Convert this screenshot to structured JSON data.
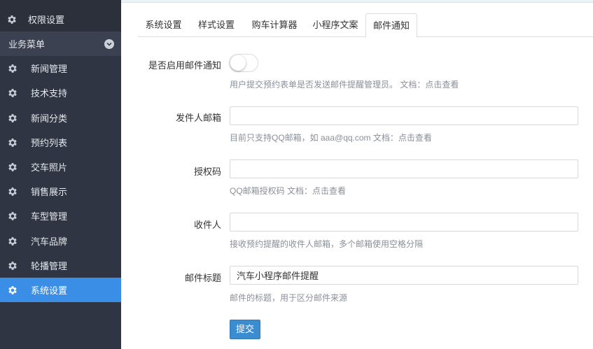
{
  "sidebar": {
    "top_item": {
      "label": "权限设置",
      "icon": "gear-icon"
    },
    "group": {
      "label": "业务菜单",
      "icon": "chevron-down-icon"
    },
    "items": [
      {
        "label": "新闻管理",
        "icon": "gear-icon"
      },
      {
        "label": "技术支持",
        "icon": "gear-icon"
      },
      {
        "label": "新闻分类",
        "icon": "gear-icon"
      },
      {
        "label": "预约列表",
        "icon": "gear-icon"
      },
      {
        "label": "交车照片",
        "icon": "gear-icon"
      },
      {
        "label": "销售展示",
        "icon": "gear-icon"
      },
      {
        "label": "车型管理",
        "icon": "gear-icon"
      },
      {
        "label": "汽车品牌",
        "icon": "gear-icon"
      },
      {
        "label": "轮播管理",
        "icon": "gear-icon"
      },
      {
        "label": "系统设置",
        "icon": "gear-icon",
        "active": true
      }
    ],
    "active_color": "#3a8ee6"
  },
  "tabs": [
    {
      "label": "系统设置"
    },
    {
      "label": "样式设置"
    },
    {
      "label": "购车计算器"
    },
    {
      "label": "小程序文案"
    },
    {
      "label": "邮件通知",
      "active": true
    }
  ],
  "form": {
    "enable_email": {
      "label": "是否启用邮件通知",
      "checked": false,
      "help": "用户提交预约表单是否发送邮件提醒管理员。 文档：点击查看"
    },
    "sender_email": {
      "label": "发件人邮箱",
      "value": "",
      "help": "目前只支持QQ邮箱，如 aaa@qq.com 文档：点击查看"
    },
    "auth_code": {
      "label": "授权码",
      "value": "",
      "help": "QQ邮箱授权码 文档：点击查看"
    },
    "recipients": {
      "label": "收件人",
      "value": "",
      "help": "接收预约提醒的收件人邮箱，多个邮箱使用空格分隔"
    },
    "email_subject": {
      "label": "邮件标题",
      "value": "汽车小程序邮件提醒",
      "help": "邮件的标题，用于区分邮件来源"
    },
    "submit_label": "提交"
  }
}
